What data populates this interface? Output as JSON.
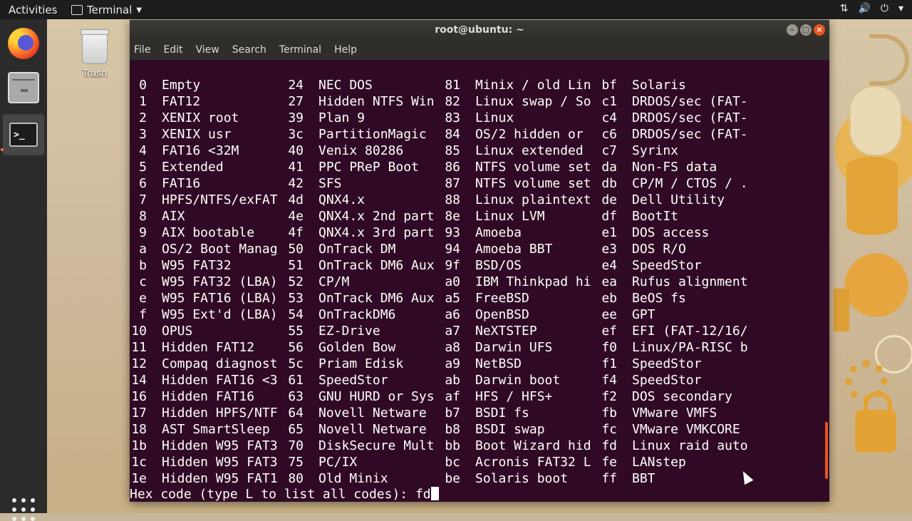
{
  "topbar": {
    "activities": "Activities",
    "app_name": "Terminal",
    "tray": [
      "network-icon",
      "volume-icon",
      "power-icon",
      "chevron-down-icon"
    ]
  },
  "desktop": {
    "trash_label": "Trash"
  },
  "window": {
    "title": "root@ubuntu: ~",
    "menu": [
      "File",
      "Edit",
      "View",
      "Search",
      "Terminal",
      "Help"
    ]
  },
  "partition_types": [
    [
      [
        "0",
        "Empty"
      ],
      [
        "24",
        "NEC DOS"
      ],
      [
        "81",
        "Minix / old Lin"
      ],
      [
        "bf",
        "Solaris"
      ]
    ],
    [
      [
        "1",
        "FAT12"
      ],
      [
        "27",
        "Hidden NTFS Win"
      ],
      [
        "82",
        "Linux swap / So"
      ],
      [
        "c1",
        "DRDOS/sec (FAT-"
      ]
    ],
    [
      [
        "2",
        "XENIX root"
      ],
      [
        "39",
        "Plan 9"
      ],
      [
        "83",
        "Linux"
      ],
      [
        "c4",
        "DRDOS/sec (FAT-"
      ]
    ],
    [
      [
        "3",
        "XENIX usr"
      ],
      [
        "3c",
        "PartitionMagic"
      ],
      [
        "84",
        "OS/2 hidden or"
      ],
      [
        "c6",
        "DRDOS/sec (FAT-"
      ]
    ],
    [
      [
        "4",
        "FAT16 <32M"
      ],
      [
        "40",
        "Venix 80286"
      ],
      [
        "85",
        "Linux extended"
      ],
      [
        "c7",
        "Syrinx"
      ]
    ],
    [
      [
        "5",
        "Extended"
      ],
      [
        "41",
        "PPC PReP Boot"
      ],
      [
        "86",
        "NTFS volume set"
      ],
      [
        "da",
        "Non-FS data"
      ]
    ],
    [
      [
        "6",
        "FAT16"
      ],
      [
        "42",
        "SFS"
      ],
      [
        "87",
        "NTFS volume set"
      ],
      [
        "db",
        "CP/M / CTOS / ."
      ]
    ],
    [
      [
        "7",
        "HPFS/NTFS/exFAT"
      ],
      [
        "4d",
        "QNX4.x"
      ],
      [
        "88",
        "Linux plaintext"
      ],
      [
        "de",
        "Dell Utility"
      ]
    ],
    [
      [
        "8",
        "AIX"
      ],
      [
        "4e",
        "QNX4.x 2nd part"
      ],
      [
        "8e",
        "Linux LVM"
      ],
      [
        "df",
        "BootIt"
      ]
    ],
    [
      [
        "9",
        "AIX bootable"
      ],
      [
        "4f",
        "QNX4.x 3rd part"
      ],
      [
        "93",
        "Amoeba"
      ],
      [
        "e1",
        "DOS access"
      ]
    ],
    [
      [
        "a",
        "OS/2 Boot Manag"
      ],
      [
        "50",
        "OnTrack DM"
      ],
      [
        "94",
        "Amoeba BBT"
      ],
      [
        "e3",
        "DOS R/O"
      ]
    ],
    [
      [
        "b",
        "W95 FAT32"
      ],
      [
        "51",
        "OnTrack DM6 Aux"
      ],
      [
        "9f",
        "BSD/OS"
      ],
      [
        "e4",
        "SpeedStor"
      ]
    ],
    [
      [
        "c",
        "W95 FAT32 (LBA)"
      ],
      [
        "52",
        "CP/M"
      ],
      [
        "a0",
        "IBM Thinkpad hi"
      ],
      [
        "ea",
        "Rufus alignment"
      ]
    ],
    [
      [
        "e",
        "W95 FAT16 (LBA)"
      ],
      [
        "53",
        "OnTrack DM6 Aux"
      ],
      [
        "a5",
        "FreeBSD"
      ],
      [
        "eb",
        "BeOS fs"
      ]
    ],
    [
      [
        "f",
        "W95 Ext'd (LBA)"
      ],
      [
        "54",
        "OnTrackDM6"
      ],
      [
        "a6",
        "OpenBSD"
      ],
      [
        "ee",
        "GPT"
      ]
    ],
    [
      [
        "10",
        "OPUS"
      ],
      [
        "55",
        "EZ-Drive"
      ],
      [
        "a7",
        "NeXTSTEP"
      ],
      [
        "ef",
        "EFI (FAT-12/16/"
      ]
    ],
    [
      [
        "11",
        "Hidden FAT12"
      ],
      [
        "56",
        "Golden Bow"
      ],
      [
        "a8",
        "Darwin UFS"
      ],
      [
        "f0",
        "Linux/PA-RISC b"
      ]
    ],
    [
      [
        "12",
        "Compaq diagnost"
      ],
      [
        "5c",
        "Priam Edisk"
      ],
      [
        "a9",
        "NetBSD"
      ],
      [
        "f1",
        "SpeedStor"
      ]
    ],
    [
      [
        "14",
        "Hidden FAT16 <3"
      ],
      [
        "61",
        "SpeedStor"
      ],
      [
        "ab",
        "Darwin boot"
      ],
      [
        "f4",
        "SpeedStor"
      ]
    ],
    [
      [
        "16",
        "Hidden FAT16"
      ],
      [
        "63",
        "GNU HURD or Sys"
      ],
      [
        "af",
        "HFS / HFS+"
      ],
      [
        "f2",
        "DOS secondary"
      ]
    ],
    [
      [
        "17",
        "Hidden HPFS/NTF"
      ],
      [
        "64",
        "Novell Netware"
      ],
      [
        "b7",
        "BSDI fs"
      ],
      [
        "fb",
        "VMware VMFS"
      ]
    ],
    [
      [
        "18",
        "AST SmartSleep"
      ],
      [
        "65",
        "Novell Netware"
      ],
      [
        "b8",
        "BSDI swap"
      ],
      [
        "fc",
        "VMware VMKCORE"
      ]
    ],
    [
      [
        "1b",
        "Hidden W95 FAT3"
      ],
      [
        "70",
        "DiskSecure Mult"
      ],
      [
        "bb",
        "Boot Wizard hid"
      ],
      [
        "fd",
        "Linux raid auto"
      ]
    ],
    [
      [
        "1c",
        "Hidden W95 FAT3"
      ],
      [
        "75",
        "PC/IX"
      ],
      [
        "bc",
        "Acronis FAT32 L"
      ],
      [
        "fe",
        "LANstep"
      ]
    ],
    [
      [
        "1e",
        "Hidden W95 FAT1"
      ],
      [
        "80",
        "Old Minix"
      ],
      [
        "be",
        "Solaris boot"
      ],
      [
        "ff",
        "BBT"
      ]
    ]
  ],
  "prompt": {
    "text": "Hex code (type L to list all codes): ",
    "input": "fd"
  }
}
